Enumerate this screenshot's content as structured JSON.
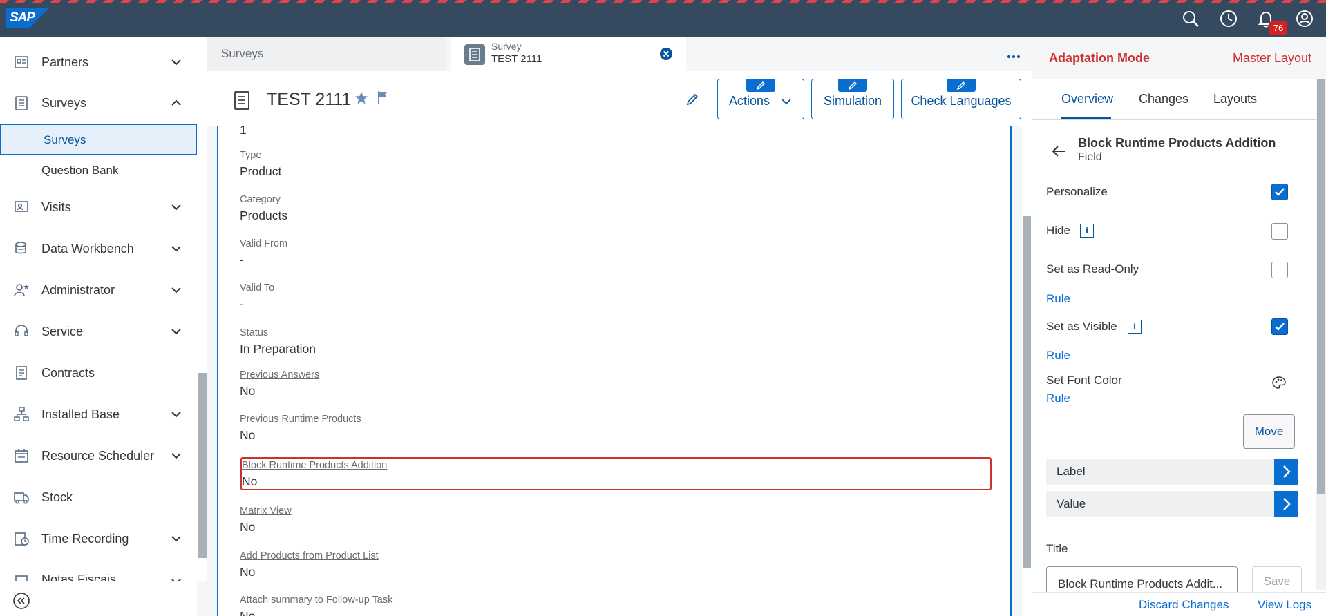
{
  "shell": {
    "logo": "SAP",
    "notifications_count": "76",
    "colors": {
      "bar": "#354a5f",
      "accent": "#0a6ed1",
      "stripe": "#e04545"
    }
  },
  "sidebar": {
    "items": [
      {
        "label": "Partners",
        "icon": "partners-icon"
      },
      {
        "label": "Surveys",
        "icon": "surveys-icon"
      },
      {
        "label": "Surveys"
      },
      {
        "label": "Question Bank"
      },
      {
        "label": "Visits",
        "icon": "visits-icon"
      },
      {
        "label": "Data Workbench",
        "icon": "data-workbench-icon"
      },
      {
        "label": "Administrator",
        "icon": "administrator-icon"
      },
      {
        "label": "Service",
        "icon": "service-icon"
      },
      {
        "label": "Contracts",
        "icon": "contracts-icon"
      },
      {
        "label": "Installed Base",
        "icon": "installed-base-icon"
      },
      {
        "label": "Resource Scheduler",
        "icon": "resource-scheduler-icon"
      },
      {
        "label": "Stock",
        "icon": "stock-icon"
      },
      {
        "label": "Time Recording",
        "icon": "time-recording-icon"
      },
      {
        "label": "Notas Fiscais",
        "icon": "notas-fiscais-icon"
      }
    ]
  },
  "tabs": {
    "tab1": "Surveys",
    "tab2_type": "Survey",
    "tab2_title": "TEST 2111"
  },
  "header": {
    "title": "TEST 2111",
    "actions_label": "Actions",
    "simulation_label": "Simulation",
    "check_languages_label": "Check Languages"
  },
  "fields": {
    "top_value": "1",
    "type_label": "Type",
    "type_value": "Product",
    "category_label": "Category",
    "category_value": "Products",
    "valid_from_label": "Valid From",
    "valid_from_value": "-",
    "valid_to_label": "Valid To",
    "valid_to_value": "-",
    "status_label": "Status",
    "status_value": "In Preparation",
    "previous_answers_label": "Previous Answers",
    "previous_answers_value": "No",
    "previous_runtime_label": "Previous Runtime Products",
    "previous_runtime_value": "No",
    "block_runtime_label": "Block Runtime Products Addition",
    "block_runtime_value": "No",
    "matrix_view_label": "Matrix View",
    "matrix_view_value": "No",
    "add_products_label": "Add Products from Product List",
    "add_products_value": "No",
    "attach_summary_label": "Attach summary to Follow-up Task",
    "attach_summary_value": "No"
  },
  "panel": {
    "mode": "Adaptation Mode",
    "master_layout": "Master Layout",
    "tabs": [
      "Overview",
      "Changes",
      "Layouts"
    ],
    "breadcrumb_title": "Block Runtime Products Addition",
    "breadcrumb_sub": "Field",
    "personalize_label": "Personalize",
    "personalize_checked": true,
    "hide_label": "Hide",
    "hide_checked": false,
    "readonly_label": "Set as Read-Only",
    "readonly_checked": false,
    "rule1": "Rule",
    "visible_label": "Set as Visible",
    "visible_checked": true,
    "rule2": "Rule",
    "font_color_label": "Set Font Color",
    "rule3": "Rule",
    "move_label": "Move",
    "accordion_label": "Label",
    "accordion_value": "Value",
    "title_label": "Title",
    "title_input_value": "Block Runtime Products Addit...",
    "save_label": "Save",
    "discard_label": "Discard Changes",
    "view_logs_label": "View Logs",
    "colors": {
      "mode_text": "#d02f2f"
    }
  }
}
